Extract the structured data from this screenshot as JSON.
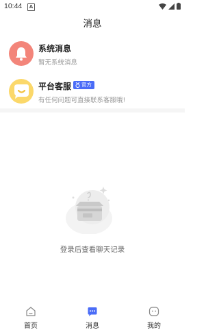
{
  "status": {
    "time": "10:44",
    "notif_glyph": "A"
  },
  "header": {
    "title": "消息"
  },
  "messages": [
    {
      "title": "系统消息",
      "desc": "暂无系统消息",
      "icon": "bell-icon",
      "color": "#f3857a"
    },
    {
      "title": "平台客服",
      "desc": "有任何问题可直接联系客服哦!",
      "icon": "chat-bubble-icon",
      "color": "#fbd86a",
      "badge": "官方"
    }
  ],
  "empty": {
    "text": "登录后查看聊天记录",
    "icon": "empty-box-icon"
  },
  "tabbar": {
    "items": [
      {
        "label": "首页",
        "icon": "home-icon"
      },
      {
        "label": "消息",
        "icon": "message-icon",
        "active": true
      },
      {
        "label": "我的",
        "icon": "profile-icon"
      }
    ],
    "active_color": "#4a6cf7"
  }
}
